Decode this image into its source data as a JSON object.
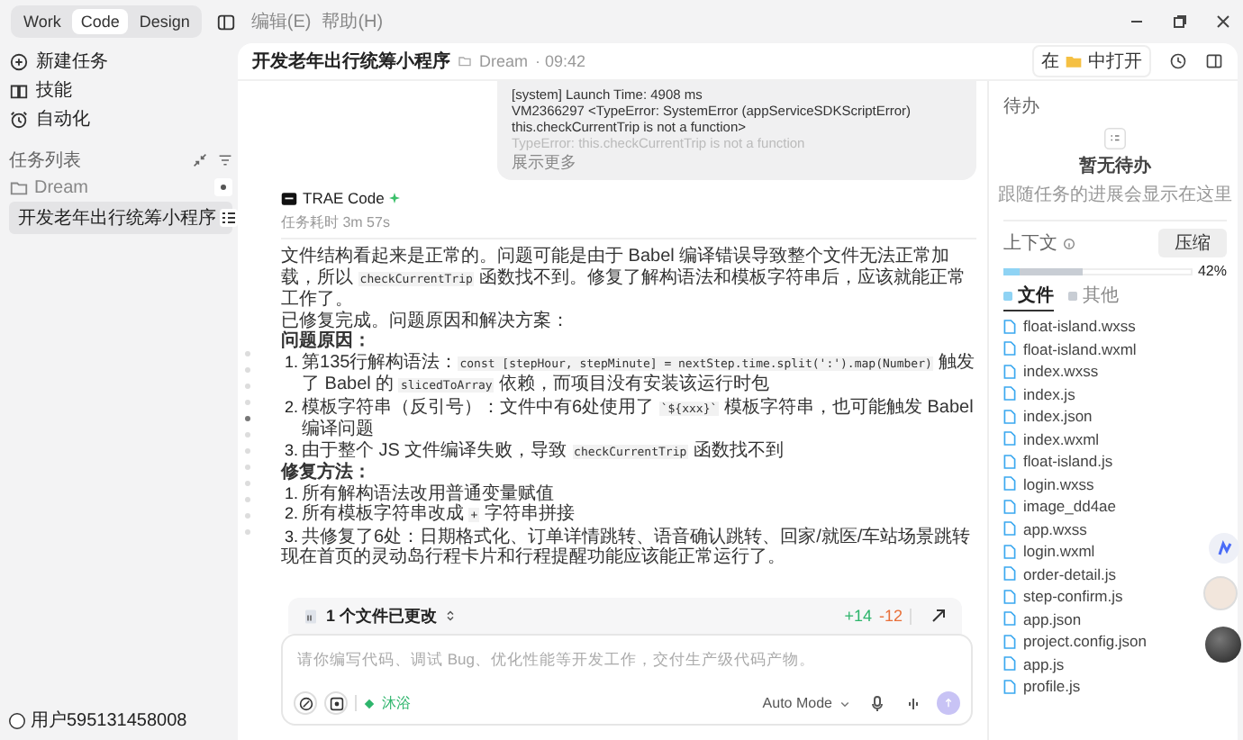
{
  "window": {
    "modes": [
      {
        "label": "Work",
        "selected": false
      },
      {
        "label": "Code",
        "selected": true
      },
      {
        "label": "Design",
        "selected": false
      }
    ],
    "menus": [
      "编辑(E)",
      "帮助(H)"
    ]
  },
  "sidebar": {
    "actions": [
      {
        "kind": "new",
        "label": "新建任务"
      },
      {
        "kind": "skill",
        "label": "技能"
      },
      {
        "kind": "auto",
        "label": "自动化"
      }
    ],
    "section_title": "任务列表",
    "tree": [
      {
        "label": "Dream",
        "children": [
          {
            "label": "开发老年出行统筹小程序",
            "selected": true
          }
        ]
      }
    ],
    "user": "用户595131458008"
  },
  "header": {
    "title": "开发老年出行统筹小程序",
    "folder": "Dream",
    "time": "· 09:42",
    "open_prefix": "在",
    "open_suffix": "中打开"
  },
  "chat": {
    "log": [
      {
        "text": "[system] Launch Time: 4908 ms",
        "faded": false
      },
      {
        "text": "VM2366297 <TypeError: SystemError (appServiceSDKScriptError)",
        "faded": false
      },
      {
        "text": "this.checkCurrentTrip is not a function>",
        "faded": false
      },
      {
        "text": "TypeError: this.checkCurrentTrip is not a function",
        "faded": true
      }
    ],
    "show_more": "展示更多",
    "agent": "TRAE Code",
    "duration": "任务耗时 3m 57s",
    "blocks": [
      {
        "kind": "paragraph",
        "parts": [
          {
            "kind": "text",
            "text": "文件结构看起来是正常的。问题可能是由于 Babel 编译错误导致整个文件无法正常加载，所以 "
          },
          {
            "kind": "code",
            "text": "checkCurrentTrip"
          },
          {
            "kind": "text",
            "text": " 函数找不到。修复了解构语法和模板字符串后，应该就能正常工作了。"
          }
        ]
      },
      {
        "kind": "paragraph",
        "parts": [
          {
            "kind": "text",
            "text": "已修复完成。问题原因和解决方案："
          }
        ]
      },
      {
        "kind": "heading",
        "text": "问题原因："
      },
      {
        "kind": "item",
        "number": "1.",
        "parts": [
          {
            "kind": "text",
            "text": "第135行解构语法："
          },
          {
            "kind": "code",
            "text": "const [stepHour, stepMinute] = nextStep.time.split(':').map(Number)"
          },
          {
            "kind": "text",
            "text": " 触发了 Babel 的 "
          },
          {
            "kind": "code",
            "text": "slicedToArray"
          },
          {
            "kind": "text",
            "text": " 依赖，而项目没有安装该运行时包"
          }
        ]
      },
      {
        "kind": "item",
        "number": "2.",
        "parts": [
          {
            "kind": "text",
            "text": "模板字符串（反引号）：文件中有6处使用了 "
          },
          {
            "kind": "code",
            "text": "`${xxx}`"
          },
          {
            "kind": "text",
            "text": " 模板字符串，也可能触发 Babel 编译问题"
          }
        ]
      },
      {
        "kind": "item",
        "number": "3.",
        "parts": [
          {
            "kind": "text",
            "text": "由于整个 JS 文件编译失败，导致 "
          },
          {
            "kind": "code",
            "text": "checkCurrentTrip"
          },
          {
            "kind": "text",
            "text": " 函数找不到"
          }
        ]
      },
      {
        "kind": "heading",
        "text": "修复方法："
      },
      {
        "kind": "item",
        "number": "1.",
        "parts": [
          {
            "kind": "text",
            "text": "所有解构语法改用普通变量赋值"
          }
        ]
      },
      {
        "kind": "item",
        "number": "2.",
        "parts": [
          {
            "kind": "text",
            "text": "所有模板字符串改成 "
          },
          {
            "kind": "code",
            "text": "+"
          },
          {
            "kind": "text",
            "text": " 字符串拼接"
          }
        ]
      },
      {
        "kind": "item",
        "number": "3.",
        "parts": [
          {
            "kind": "text",
            "text": "共修复了6处：日期格式化、订单详情跳转、语音确认跳转、回家/就医/车站场景跳转"
          }
        ]
      },
      {
        "kind": "paragraph",
        "parts": [
          {
            "kind": "text",
            "text": "现在首页的灵动岛行程卡片和行程提醒功能应该能正常运行了。"
          }
        ]
      }
    ]
  },
  "changes": {
    "label": "1 个文件已更改",
    "added": "+14",
    "removed": "-12"
  },
  "composer": {
    "placeholder": "请你编写代码、调试 Bug、优化性能等开发工作，交付生产级代码产物。",
    "mode_tag": "沐浴",
    "model": "Auto Mode"
  },
  "todo": {
    "title": "待办",
    "empty_title": "暂无待办",
    "empty_hint": "跟随任务的进展会显示在这里"
  },
  "context": {
    "title": "上下文",
    "compress": "压缩",
    "percent": "42%",
    "usage": [
      {
        "level": 0.42,
        "color": "#c8cdd4"
      },
      {
        "level": 0.09,
        "color": "#8fd3f4"
      }
    ],
    "tabs": [
      {
        "label": "文件",
        "selected": true,
        "color": "#8fd3f4"
      },
      {
        "label": "其他",
        "selected": false,
        "color": "#c8cdd4"
      }
    ]
  },
  "files": [
    "float-island.wxss",
    "float-island.wxml",
    "index.wxss",
    "index.js",
    "index.json",
    "index.wxml",
    "float-island.js",
    "login.wxss",
    "image_dd4ae",
    "app.wxss",
    "login.wxml",
    "order-detail.js",
    "step-confirm.js",
    "app.json",
    "project.config.json",
    "app.js",
    "profile.js"
  ]
}
